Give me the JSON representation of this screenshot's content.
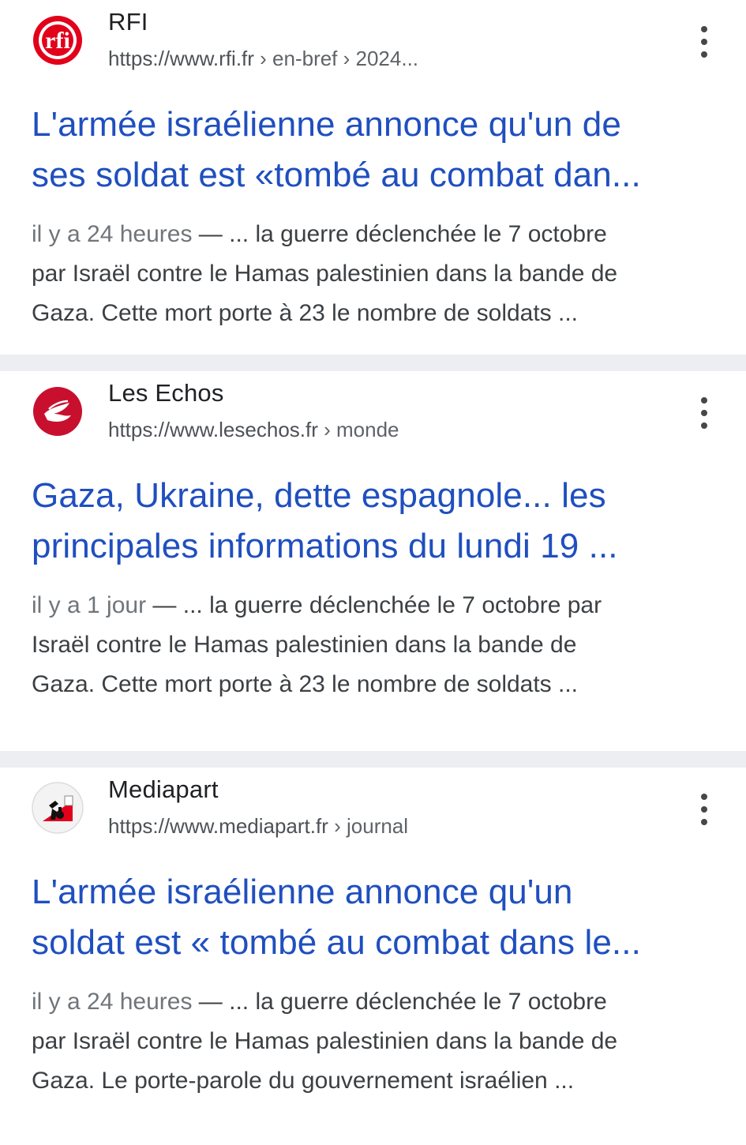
{
  "results": [
    {
      "source": "RFI",
      "logo_text": "rfi",
      "url_base": "https://www.rfi.fr",
      "url_path": " › en-bref › 2024...",
      "title_lines": [
        "L'armée israélienne annonce qu'un de",
        "ses soldat est «tombé au combat dan..."
      ],
      "date": "il y a 24 heures",
      "snippet_lines": [
        " — ... la guerre déclenchée le 7 octobre",
        "par Israël contre le Hamas palestinien dans la bande de",
        "Gaza. Cette mort porte à 23 le nombre de soldats ..."
      ]
    },
    {
      "source": "Les Echos",
      "logo_text": "",
      "url_base": "https://www.lesechos.fr",
      "url_path": " › monde",
      "title_lines": [
        "Gaza, Ukraine, dette espagnole... les",
        "principales informations du lundi 19 ..."
      ],
      "date": "il y a 1 jour",
      "snippet_lines": [
        " — ... la guerre déclenchée le 7 octobre par",
        "Israël contre le Hamas palestinien dans la bande de",
        "Gaza. Cette mort porte à 23 le nombre de soldats ..."
      ]
    },
    {
      "source": "Mediapart",
      "logo_text": "",
      "url_base": "https://www.mediapart.fr",
      "url_path": " › journal",
      "title_lines": [
        "L'armée israélienne annonce qu'un",
        "soldat est « tombé au combat dans le..."
      ],
      "date": "il y a 24 heures",
      "snippet_lines": [
        " — ... la guerre déclenchée le 7 octobre",
        "par Israël contre le Hamas palestinien dans la bande de",
        "Gaza. Le porte-parole du gouvernement israélien ..."
      ]
    }
  ],
  "colors": {
    "title_link": "#1f4fbf",
    "rfi_red": "#e2001a",
    "lesechos_red": "#c8102e",
    "divider": "#eceef1"
  }
}
